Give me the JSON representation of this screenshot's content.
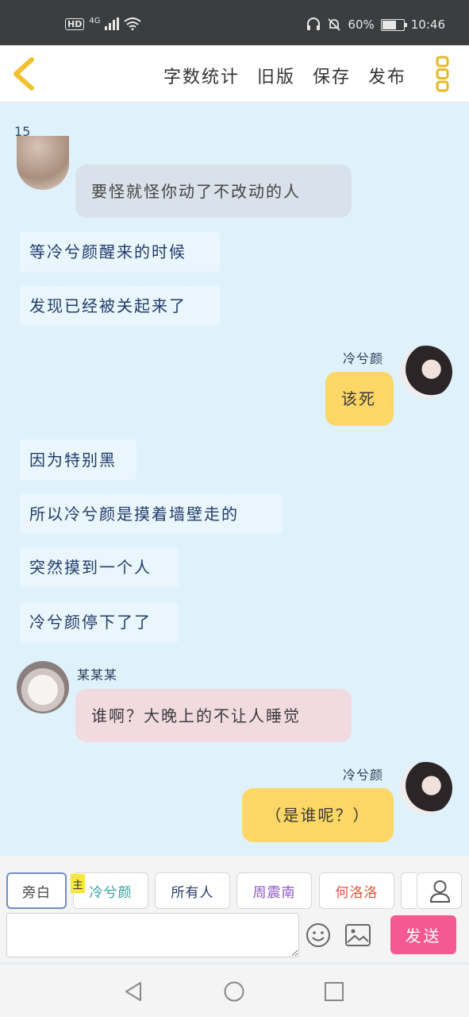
{
  "status_bar": {
    "hd": "HD",
    "network": "4G",
    "battery_percent": "60%",
    "battery_level": 0.6,
    "time": "10:46"
  },
  "toolbar": {
    "word_count": "字数统计",
    "old_version": "旧版",
    "save": "保存",
    "publish": "发布"
  },
  "chat": {
    "count": "15",
    "messages": [
      {
        "kind": "reply",
        "text": "要怪就怪你动了不改动的人"
      },
      {
        "kind": "narration",
        "text": "等冷兮颜醒来的时候"
      },
      {
        "kind": "narration",
        "text": "发现已经被关起来了"
      },
      {
        "kind": "right",
        "name": "冷兮颜",
        "text": "该死"
      },
      {
        "kind": "narration",
        "text": "因为特别黑"
      },
      {
        "kind": "narration",
        "text": "所以冷兮颜是摸着墙壁走的"
      },
      {
        "kind": "narration",
        "text": "突然摸到一个人"
      },
      {
        "kind": "narration",
        "text": "冷兮颜停下了了"
      },
      {
        "kind": "left",
        "name": "某某某",
        "text": "谁啊？大晚上的不让人睡觉"
      },
      {
        "kind": "right",
        "name": "冷兮颜",
        "text": "（是谁呢？）"
      }
    ]
  },
  "roles": [
    {
      "label": "旁白",
      "color": "#444444"
    },
    {
      "label": "冷兮颜",
      "color": "#2fa3a0",
      "tag": "主"
    },
    {
      "label": "所有人",
      "color": "#2a3d6b"
    },
    {
      "label": "周震南",
      "color": "#8a55c8"
    },
    {
      "label": "何洛洛",
      "color": "#e05438"
    }
  ],
  "composer": {
    "placeholder": "",
    "send_label": "发送"
  },
  "colors": {
    "accent_yellow": "#fcd766",
    "send_pink": "#f45a8f",
    "chat_bg": "#dff1fb"
  }
}
